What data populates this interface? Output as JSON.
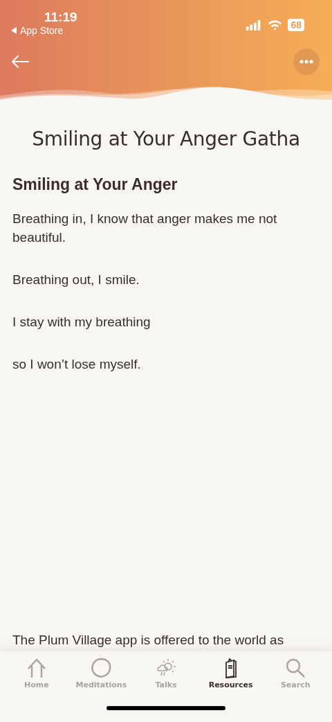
{
  "status_bar": {
    "time": "11:19",
    "back_app": "App Store",
    "battery": "68"
  },
  "title": "Smiling at Your Anger Gatha",
  "heading": "Smiling at Your Anger",
  "verses": [
    "Breathing in, I know that anger makes me not beautiful.",
    "Breathing out, I smile.",
    "I stay with my breathing",
    "so I won’t lose myself."
  ],
  "footer_text": "The Plum Village app is offered to the world as",
  "tabs": [
    {
      "kind": "home",
      "label": "Home",
      "selected": false
    },
    {
      "kind": "meditations",
      "label": "Meditations",
      "selected": false
    },
    {
      "kind": "talks",
      "label": "Talks",
      "selected": false
    },
    {
      "kind": "resources",
      "label": "Resources",
      "selected": true
    },
    {
      "kind": "search",
      "label": "Search",
      "selected": false
    }
  ]
}
